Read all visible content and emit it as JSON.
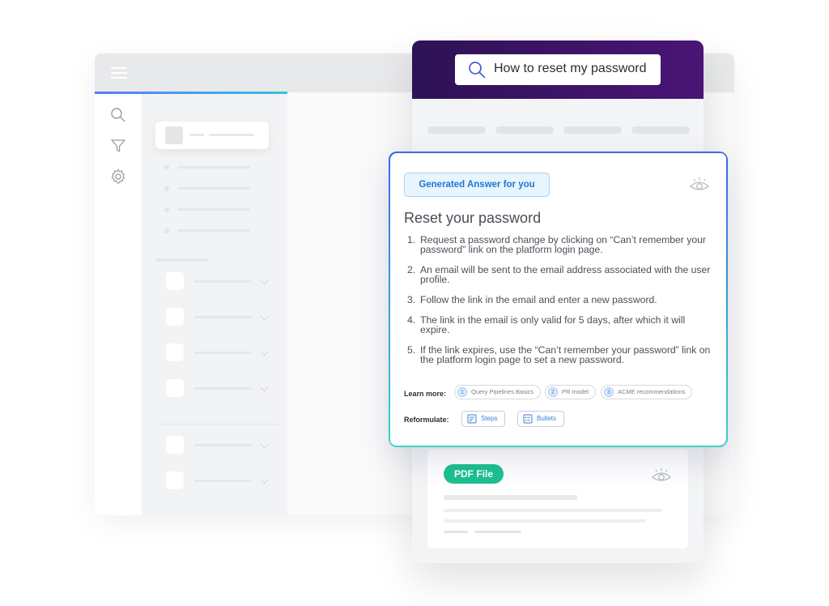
{
  "search": {
    "query": "How to reset my password"
  },
  "answer": {
    "badge": "Generated Answer for you",
    "title": "Reset your password",
    "steps": [
      {
        "num": "1.",
        "text": "Request a password change by clicking on “Can’t remember your password” link on the platform login page."
      },
      {
        "num": "2.",
        "text": "An email will be sent to the email address associated with the user profile."
      },
      {
        "num": "3.",
        "text": "Follow the link in the email and enter a new password."
      },
      {
        "num": "4.",
        "text": "The link in the email is only valid for 5 days, after which it will expire."
      },
      {
        "num": "5.",
        "text": "If the link expires, use the “Can’t remember your password” link on the platform login page to set a new password."
      }
    ],
    "learn_more_label": "Learn more:",
    "sources": [
      {
        "num": "1",
        "label": "Query Pipelines Basics"
      },
      {
        "num": "2",
        "label": "PR model"
      },
      {
        "num": "3",
        "label": "ACME recommendations"
      }
    ],
    "reformulate_label": "Reformulate:",
    "reformulate_options": [
      {
        "label": "Steps",
        "icon": "steps-icon"
      },
      {
        "label": "Bullets",
        "icon": "bullets-icon"
      }
    ]
  },
  "result": {
    "badge": "PDF File"
  },
  "colors": {
    "header_gradient": [
      "#2e1255",
      "#4a1576"
    ],
    "accent_blue": "#1b78d4",
    "pdf_badge": "#1cc190",
    "answer_border_gradient": [
      "#3e66e6",
      "#39d3c4"
    ]
  }
}
